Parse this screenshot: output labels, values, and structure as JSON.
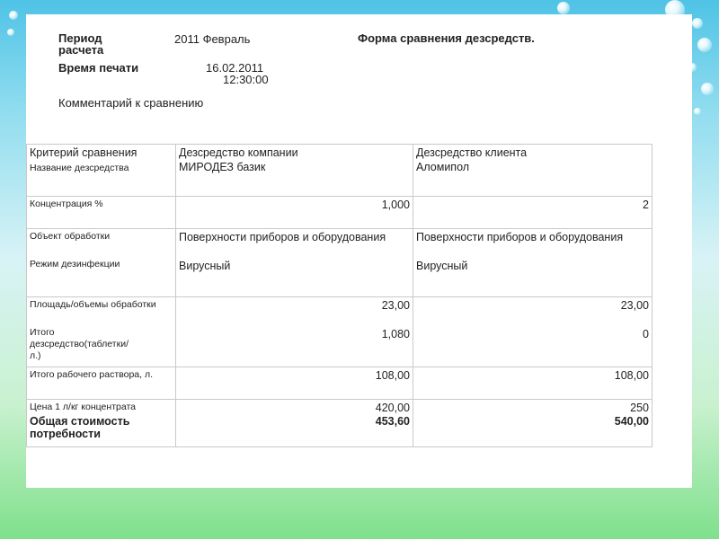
{
  "header": {
    "period_label": "Период расчета",
    "period_value": "2011 Февраль",
    "form_title": "Форма сравнения дезсредств.",
    "print_time_label": "Время печати",
    "print_date": "16.02.2011",
    "print_time": "12:30:00",
    "comment_label": "Комментарий к сравнению"
  },
  "table": {
    "col_headers": [
      "Критерий сравнения",
      "Дезсредство компании",
      "Дезсредство клиента"
    ],
    "rows": {
      "name": {
        "label": "Название дезсредства",
        "company": "МИРОДЕЗ базик",
        "client": "Аломипол"
      },
      "concentration": {
        "label": "Концентрация %",
        "company": "1,000",
        "client": "2"
      },
      "object": {
        "label": "Объект обработки",
        "company": "Поверхности приборов и оборудования",
        "client": "Поверхности приборов и оборудования"
      },
      "mode": {
        "label": "Режим дезинфекции",
        "company": "Вирусный",
        "client": "Вирусный"
      },
      "area": {
        "label": "Площадь/объемы обработки",
        "company": "23,00",
        "client": "23,00"
      },
      "total_disinfectant": {
        "label": "Итого дезсредство(таблетки/л.)",
        "company": "1,080",
        "client": "0"
      },
      "total_solution": {
        "label": "Итого рабочего раствора, л.",
        "company": "108,00",
        "client": "108,00"
      },
      "price": {
        "label": "Цена 1 л/кг концентрата",
        "company": "420,00",
        "client": "250"
      },
      "total_cost": {
        "label": "Общая стоимость потребности",
        "company": "453,60",
        "client": "540,00"
      }
    }
  }
}
